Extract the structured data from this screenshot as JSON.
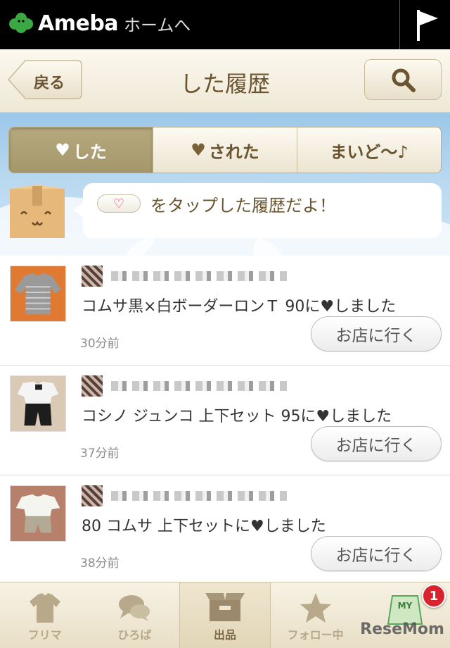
{
  "topbar": {
    "brand": "Ameba",
    "home_link": "ホームへ",
    "icons": {
      "logo": "ameba-leaf-icon",
      "flag": "flag-icon"
    }
  },
  "navbar": {
    "back_label": "戻る",
    "title": "した履歴",
    "search_icon": "search-icon"
  },
  "segments": [
    {
      "heart": "♥",
      "label": "した",
      "active": true
    },
    {
      "heart": "♥",
      "label": "された",
      "active": false
    },
    {
      "heart": "",
      "label": "まいど〜♪",
      "active": false
    }
  ],
  "bubble": {
    "pill_heart": "♡",
    "message": "をタップした履歴だよ！"
  },
  "items": [
    {
      "desc": "コムサ黒×白ボーダーロンＴ 90に♥しました",
      "time": "30分前",
      "button": "お店に行く"
    },
    {
      "desc": "コシノ ジュンコ 上下セット 95に♥しました",
      "time": "37分前",
      "button": "お店に行く"
    },
    {
      "desc": "80 コムサ 上下セットに♥しました",
      "time": "38分前",
      "button": "お店に行く"
    }
  ],
  "tabbar": {
    "tabs": [
      {
        "label": "フリマ",
        "icon": "shirt-icon"
      },
      {
        "label": "ひろば",
        "icon": "chat-bubbles-icon"
      },
      {
        "label": "出品",
        "icon": "box-icon"
      },
      {
        "label": "フォロー中",
        "icon": "star-icon"
      },
      {
        "label": "MY",
        "icon": "my-sign-icon"
      }
    ],
    "badge": "1",
    "watermark": "ReseMom"
  },
  "colors": {
    "accent_brown": "#6b5430",
    "segment_active": "#a4976b",
    "badge_red": "#d8232f"
  }
}
